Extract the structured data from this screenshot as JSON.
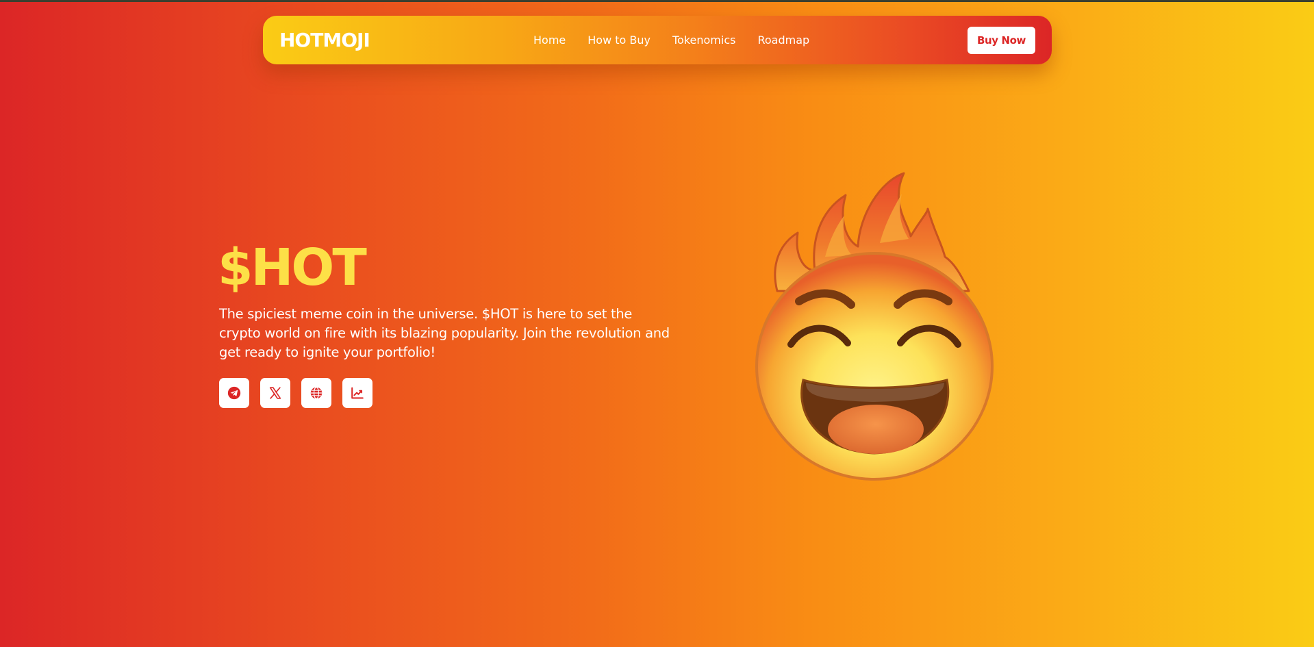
{
  "nav": {
    "logo": "HOTMOJI",
    "links": [
      "Home",
      "How to Buy",
      "Tokenomics",
      "Roadmap"
    ],
    "buy_label": "Buy Now"
  },
  "hero": {
    "title": "$HOT",
    "description": "The spiciest meme coin in the universe. $HOT is here to set the crypto world on fire with its blazing popularity. Join the revolution and get ready to ignite your portfolio!",
    "socials": [
      "telegram-icon",
      "x-icon",
      "globe-icon",
      "chart-icon"
    ],
    "mascot": "fire-emoji"
  },
  "colors": {
    "brand_red": "#dc2626",
    "brand_yellow": "#facc15",
    "title_yellow": "#fde047",
    "white": "#ffffff"
  }
}
